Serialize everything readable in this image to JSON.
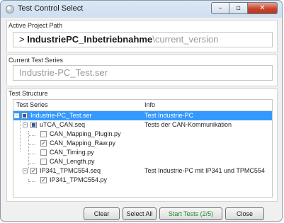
{
  "window": {
    "title": "Test Control Select",
    "controls": {
      "minimize": "–",
      "maximize": "▫",
      "close": "✕"
    }
  },
  "active_project": {
    "label": "Active Project Path",
    "prefix": ">",
    "name": "IndustriePC_Inbetriebnahme",
    "suffix": "\\current_version"
  },
  "current_series": {
    "label": "Current Test Series",
    "placeholder": "Industrie-PC_Test.ser"
  },
  "structure": {
    "label": "Test Structure",
    "columns": [
      "Test Series",
      "Info"
    ],
    "rows": [
      {
        "label": "Industrie-PC_Test.ser",
        "info": "Test Industrie-PC",
        "level": 0,
        "expander": "−",
        "check": "partial",
        "selected": true
      },
      {
        "label": "uTCA_CAN.seq",
        "info": "Tests der CAN-Kommunikation",
        "level": 1,
        "expander": "−",
        "check": "partial",
        "selected": false
      },
      {
        "label": "CAN_Mapping_Plugin.py",
        "info": "",
        "level": 2,
        "check": "unchecked",
        "selected": false
      },
      {
        "label": "CAN_Mapping_Raw.py",
        "info": "",
        "level": 2,
        "check": "checked",
        "selected": false
      },
      {
        "label": "CAN_Timing.py",
        "info": "",
        "level": 2,
        "check": "unchecked",
        "selected": false
      },
      {
        "label": "CAN_Length.py",
        "info": "",
        "level": 2,
        "check": "unchecked",
        "selected": false
      },
      {
        "label": "IP341_TPMC554.seq",
        "info": "Test Industrie-PC mit IP341 und TPMC554",
        "level": 1,
        "expander": "−",
        "check": "checked",
        "selected": false
      },
      {
        "label": "IP341_TPMC554.py",
        "info": "",
        "level": 2,
        "check": "checked",
        "selected": false
      }
    ]
  },
  "buttons": {
    "clear": "Clear",
    "select_all": "Select All",
    "start": "Start Tests (2/5)",
    "close": "Close"
  }
}
